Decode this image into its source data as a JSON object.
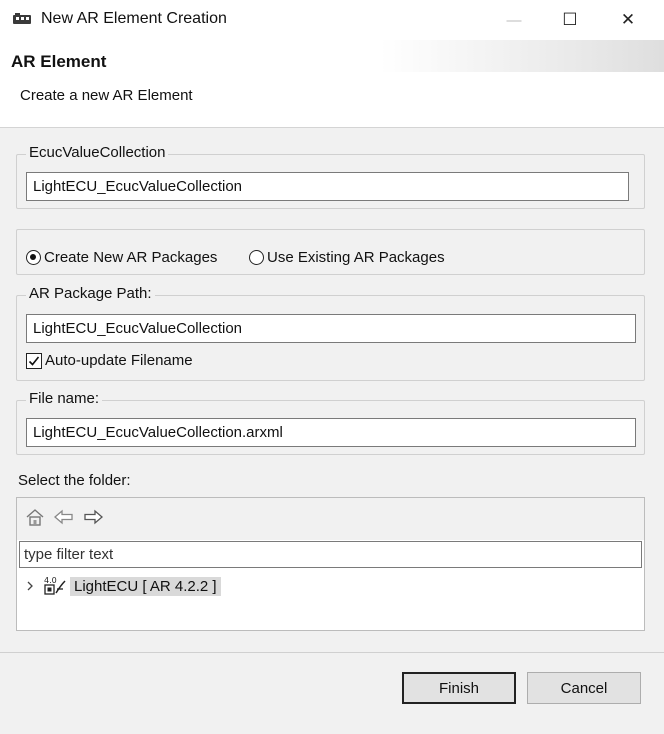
{
  "window": {
    "title": "New AR Element Creation",
    "min_symbol": "—",
    "max_symbol": "☐",
    "close_symbol": "✕"
  },
  "header": {
    "title": "AR Element",
    "description": "Create a new AR Element"
  },
  "ecuc_group": {
    "label": "EcucValueCollection",
    "value": "LightECU_EcucValueCollection"
  },
  "packages": {
    "create_new_label": "Create New AR Packages",
    "create_new_selected": true,
    "use_existing_label": "Use Existing AR Packages",
    "use_existing_selected": false
  },
  "package_path": {
    "label": "AR Package Path:",
    "value": "LightECU_EcucValueCollection",
    "auto_update_label": "Auto-update Filename",
    "auto_update_checked": true
  },
  "file_name": {
    "label": "File name:",
    "value": "LightECU_EcucValueCollection.arxml"
  },
  "folder": {
    "label": "Select the folder:",
    "filter_placeholder": "type filter text",
    "tree": [
      {
        "label": "LightECU [ AR 4.2.2 ]",
        "icon": "autosar-project-icon",
        "expanded": false,
        "selected": true
      }
    ]
  },
  "buttons": {
    "finish": "Finish",
    "cancel": "Cancel"
  },
  "colors": {
    "dialog_background": "#f1f1f1",
    "selection_highlight": "#d9d9d9"
  }
}
